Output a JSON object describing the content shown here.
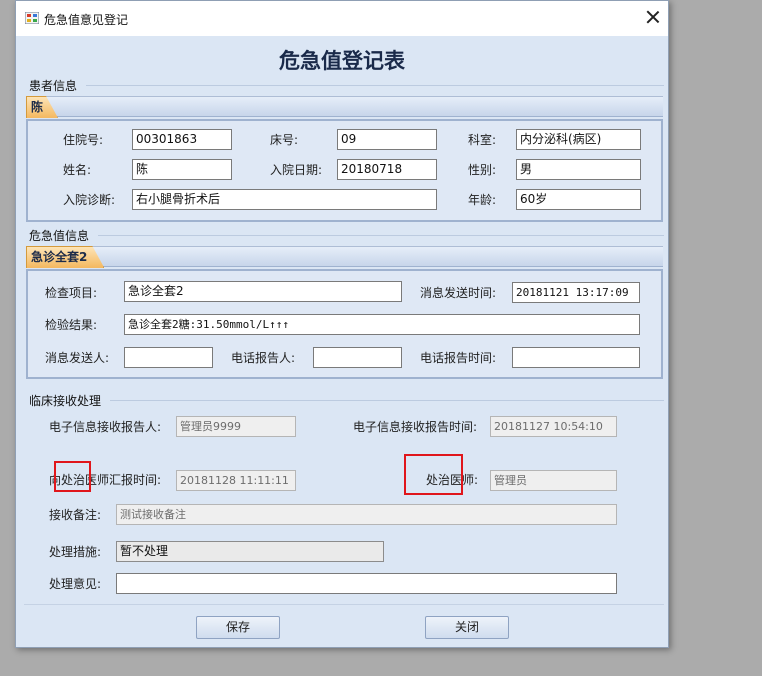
{
  "window": {
    "title": "危急值意见登记"
  },
  "form_title": "危急值登记表",
  "patient": {
    "group_title": "患者信息",
    "tab": "陈",
    "fields": {
      "admission_no": {
        "label": "住院号:",
        "value": "00301863"
      },
      "bed_no": {
        "label": "床号:",
        "value": "09"
      },
      "department": {
        "label": "科室:",
        "value": "内分泌科(病区)"
      },
      "name": {
        "label": "姓名:",
        "value": "陈"
      },
      "admission_date": {
        "label": "入院日期:",
        "value": "20180718"
      },
      "gender": {
        "label": "性别:",
        "value": "男"
      },
      "diagnosis": {
        "label": "入院诊断:",
        "value": "右小腿骨折术后"
      },
      "age": {
        "label": "年龄:",
        "value": "60岁"
      }
    }
  },
  "critical": {
    "group_title": "危急值信息",
    "tab": "急诊全套2",
    "fields": {
      "exam_item": {
        "label": "检查项目:",
        "value": "急诊全套2"
      },
      "send_time": {
        "label": "消息发送时间:",
        "value": "20181121 13:17:09"
      },
      "result": {
        "label": "检验结果:",
        "value": "急诊全套2糖:31.50mmol/L↑↑↑"
      },
      "sender": {
        "label": "消息发送人:",
        "value": ""
      },
      "phone_reporter": {
        "label": "电话报告人:",
        "value": ""
      },
      "phone_time": {
        "label": "电话报告时间:",
        "value": ""
      }
    }
  },
  "clinical": {
    "group_title": "临床接收处理",
    "fields": {
      "e_receiver": {
        "label": "电子信息接收报告人:",
        "value": "管理员9999"
      },
      "e_receive_time": {
        "label": "电子信息接收报告时间:",
        "value": "20181127 10:54:10"
      },
      "report_time": {
        "label": "向处治医师汇报时间:",
        "value": "20181128 11:11:11"
      },
      "doctor": {
        "label": "处治医师:",
        "value": "管理员"
      },
      "remark": {
        "label": "接收备注:",
        "value": "测试接收备注"
      },
      "measure": {
        "label": "处理措施:",
        "value": "暂不处理"
      },
      "opinion": {
        "label": "处理意见:",
        "value": ""
      }
    }
  },
  "buttons": {
    "save": "保存",
    "close": "关闭"
  },
  "colors": {
    "highlight_box": "#e0161b",
    "tab_accent": "#f4b860",
    "panel_border": "#9fb2cf"
  }
}
